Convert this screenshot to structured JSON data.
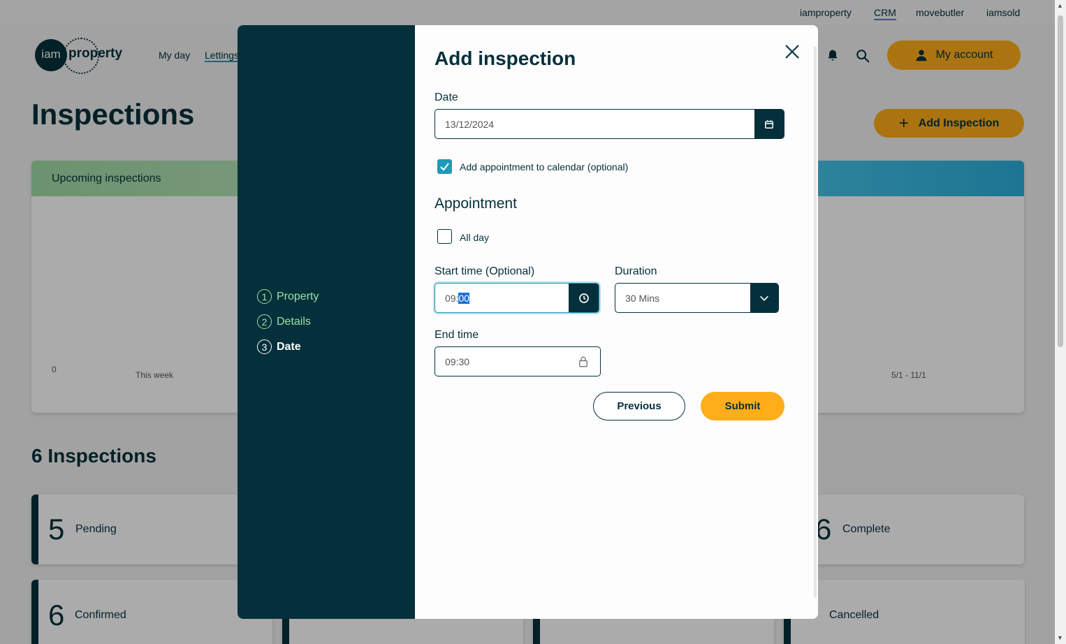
{
  "topbar": {
    "links": [
      "iamproperty",
      "CRM",
      "movebutler",
      "iamsold"
    ]
  },
  "logo": {
    "mark": "iam",
    "word": "property"
  },
  "nav": {
    "items": [
      "My day",
      "Lettings"
    ]
  },
  "header": {
    "account_label": "My account"
  },
  "page": {
    "title": "Inspections",
    "add_button": "Add Inspection",
    "upcoming_title": "Upcoming inspections",
    "chart_left": {
      "y_zero": "0",
      "x_label": "This week"
    },
    "chart_right": {
      "x_label": "5/1 - 11/1"
    },
    "count_title": "6 Inspections",
    "stats": [
      {
        "num": "5",
        "label": "Pending"
      },
      {
        "num": "6",
        "label": "Complete"
      },
      {
        "num": "6",
        "label": "Confirmed"
      },
      {
        "num": "",
        "label": "Cancelled"
      }
    ]
  },
  "modal": {
    "title": "Add inspection",
    "steps": [
      {
        "num": "1",
        "label": "Property"
      },
      {
        "num": "2",
        "label": "Details"
      },
      {
        "num": "3",
        "label": "Date"
      }
    ],
    "date_label": "Date",
    "date_value": "13/12/2024",
    "add_to_calendar_label": "Add appointment to calendar (optional)",
    "add_to_calendar_checked": true,
    "appointment_title": "Appointment",
    "all_day_label": "All day",
    "all_day_checked": false,
    "start_time_label": "Start time (Optional)",
    "start_time_hours": "09:",
    "start_time_minutes": "00",
    "duration_label": "Duration",
    "duration_value": "30 Mins",
    "end_time_label": "End time",
    "end_time_value": "09:30",
    "previous_label": "Previous",
    "submit_label": "Submit"
  },
  "colors": {
    "primary": "#04303b",
    "accent": "#ffad1a",
    "focus": "#1f9ab8",
    "step_done": "#9ee2a6"
  }
}
